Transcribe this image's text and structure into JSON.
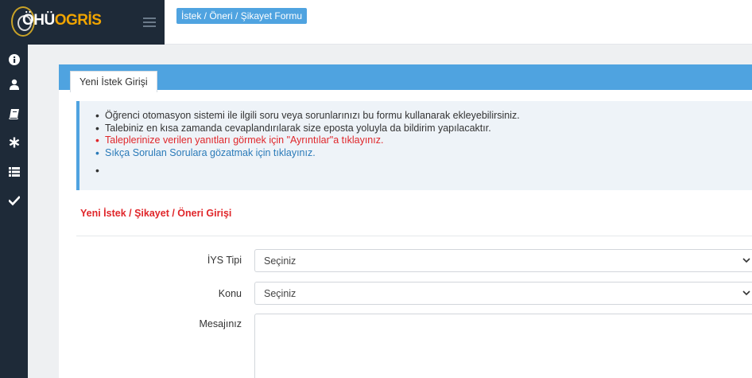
{
  "header": {
    "logo_prefix": "ÖHÜ",
    "logo_suffix": "OGRİS",
    "breadcrumb": "İstek / Öneri / Şikayet Formu"
  },
  "sidebar": {
    "items": [
      {
        "icon": "info-icon"
      },
      {
        "icon": "user-icon"
      },
      {
        "icon": "book-icon"
      },
      {
        "icon": "asterisk-icon"
      },
      {
        "icon": "list-icon"
      },
      {
        "icon": "check-icon"
      }
    ]
  },
  "panel": {
    "tab_label": "Yeni İstek Girişi",
    "info_items": [
      "Öğrenci otomasyon sistemi ile ilgili soru veya sorunlarınızı bu formu kullanarak ekleyebilirsiniz.",
      "Talebiniz en kısa zamanda cevaplandırılarak size eposta yoluyla da bildirim yapılacaktır.",
      "Taleplerinize verilen yanıtları görmek için \"Ayrıntılar\"a tıklayınız.",
      "Sıkça Sorulan Sorulara gözatmak için tıklayınız.",
      ""
    ],
    "section_title": "Yeni İstek / Şikayet / Öneri Girişi"
  },
  "form": {
    "iys_tipi": {
      "label": "İYS Tipi",
      "value": "Seçiniz"
    },
    "konu": {
      "label": "Konu",
      "value": "Seçiniz"
    },
    "mesaj": {
      "label": "Mesajınız",
      "value": ""
    }
  },
  "colors": {
    "sidebar_bg": "#1e2a38",
    "accent_blue": "#4fa3e0",
    "alert_red": "#e0262a",
    "logo_orange": "#f0a400"
  }
}
